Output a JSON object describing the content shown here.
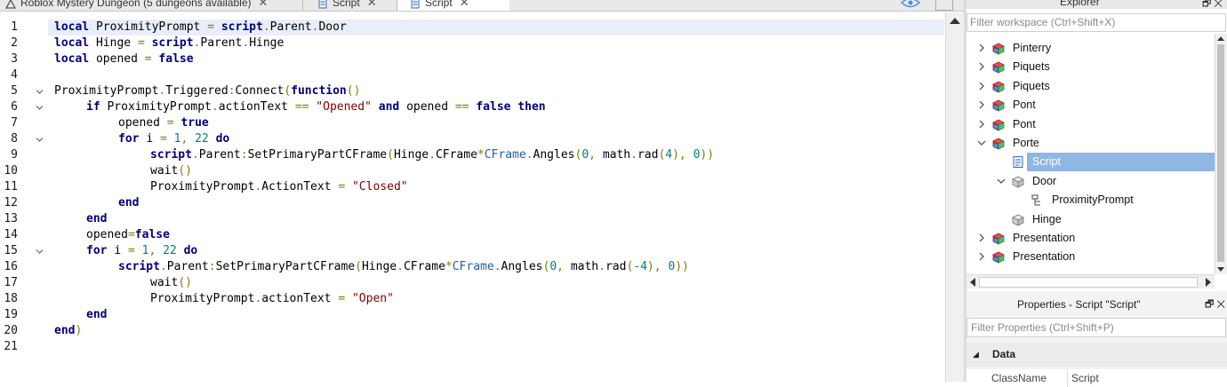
{
  "tabs": [
    {
      "label": "Roblox Mystery Dungeon (5 dungeons available)",
      "close": "✕"
    },
    {
      "label": "Script",
      "close": "✕"
    },
    {
      "label": "Script",
      "close": "✕"
    }
  ],
  "editor": {
    "lines": [
      {
        "n": "1",
        "fold": false,
        "indent": 0,
        "tokens": [
          [
            "kw",
            "local "
          ],
          [
            "idn",
            "ProximityPrompt "
          ],
          [
            "op",
            "= "
          ],
          [
            "kw",
            "script"
          ],
          [
            "op",
            "."
          ],
          [
            "idn",
            "Parent"
          ],
          [
            "op",
            "."
          ],
          [
            "idn",
            "Door"
          ]
        ]
      },
      {
        "n": "2",
        "fold": false,
        "indent": 0,
        "tokens": [
          [
            "kw",
            "local "
          ],
          [
            "idn",
            "Hinge "
          ],
          [
            "op",
            "= "
          ],
          [
            "kw",
            "script"
          ],
          [
            "op",
            "."
          ],
          [
            "idn",
            "Parent"
          ],
          [
            "op",
            "."
          ],
          [
            "idn",
            "Hinge"
          ]
        ]
      },
      {
        "n": "3",
        "fold": false,
        "indent": 0,
        "tokens": [
          [
            "kw",
            "local "
          ],
          [
            "idn",
            "opened "
          ],
          [
            "op",
            "= "
          ],
          [
            "kw",
            "false"
          ]
        ]
      },
      {
        "n": "4",
        "fold": false,
        "indent": 0,
        "tokens": []
      },
      {
        "n": "5",
        "fold": true,
        "indent": 0,
        "tokens": [
          [
            "idn",
            "ProximityPrompt"
          ],
          [
            "op",
            "."
          ],
          [
            "idn",
            "Triggered"
          ],
          [
            "op",
            ":"
          ],
          [
            "idn",
            "Connect"
          ],
          [
            "op",
            "("
          ],
          [
            "kw",
            "function"
          ],
          [
            "op",
            "()"
          ]
        ]
      },
      {
        "n": "6",
        "fold": true,
        "indent": 1,
        "tokens": [
          [
            "kw",
            "if "
          ],
          [
            "idn",
            "ProximityPrompt"
          ],
          [
            "op",
            "."
          ],
          [
            "idn",
            "actionText "
          ],
          [
            "op",
            "== "
          ],
          [
            "str",
            "\"Opened\" "
          ],
          [
            "kw",
            "and "
          ],
          [
            "idn",
            "opened "
          ],
          [
            "op",
            "== "
          ],
          [
            "kw",
            "false then"
          ]
        ]
      },
      {
        "n": "7",
        "fold": false,
        "indent": 2,
        "tokens": [
          [
            "idn",
            "opened "
          ],
          [
            "op",
            "= "
          ],
          [
            "kw",
            "true"
          ]
        ]
      },
      {
        "n": "8",
        "fold": true,
        "indent": 2,
        "tokens": [
          [
            "kw",
            "for "
          ],
          [
            "idn",
            "i "
          ],
          [
            "op",
            "= "
          ],
          [
            "num",
            "1"
          ],
          [
            "op",
            ", "
          ],
          [
            "num",
            "22 "
          ],
          [
            "kw",
            "do"
          ]
        ]
      },
      {
        "n": "9",
        "fold": false,
        "indent": 3,
        "tokens": [
          [
            "kw",
            "script"
          ],
          [
            "op",
            "."
          ],
          [
            "idn",
            "Parent"
          ],
          [
            "op",
            ":"
          ],
          [
            "idn",
            "SetPrimaryPartCFrame"
          ],
          [
            "op",
            "("
          ],
          [
            "idn",
            "Hinge"
          ],
          [
            "op",
            "."
          ],
          [
            "idn",
            "CFrame"
          ],
          [
            "op",
            "*"
          ],
          [
            "ckw",
            "CFrame"
          ],
          [
            "op",
            "."
          ],
          [
            "idn",
            "Angles"
          ],
          [
            "op",
            "("
          ],
          [
            "num",
            "0"
          ],
          [
            "op",
            ", "
          ],
          [
            "idn",
            "math"
          ],
          [
            "op",
            "."
          ],
          [
            "idn",
            "rad"
          ],
          [
            "op",
            "("
          ],
          [
            "num",
            "4"
          ],
          [
            "op",
            "), "
          ],
          [
            "num",
            "0"
          ],
          [
            "op",
            "))"
          ]
        ]
      },
      {
        "n": "10",
        "fold": false,
        "indent": 3,
        "tokens": [
          [
            "idn",
            "wait"
          ],
          [
            "op",
            "()"
          ]
        ]
      },
      {
        "n": "11",
        "fold": false,
        "indent": 3,
        "tokens": [
          [
            "idn",
            "ProximityPrompt"
          ],
          [
            "op",
            "."
          ],
          [
            "idn",
            "ActionText "
          ],
          [
            "op",
            "= "
          ],
          [
            "str",
            "\"Closed\""
          ]
        ]
      },
      {
        "n": "12",
        "fold": false,
        "indent": 2,
        "tokens": [
          [
            "kw",
            "end"
          ]
        ]
      },
      {
        "n": "13",
        "fold": false,
        "indent": 1,
        "tokens": [
          [
            "kw",
            "end"
          ]
        ]
      },
      {
        "n": "14",
        "fold": false,
        "indent": 1,
        "tokens": [
          [
            "idn",
            "opened"
          ],
          [
            "op",
            "="
          ],
          [
            "kw",
            "false"
          ]
        ]
      },
      {
        "n": "15",
        "fold": true,
        "indent": 1,
        "tokens": [
          [
            "kw",
            "for "
          ],
          [
            "idn",
            "i "
          ],
          [
            "op",
            "= "
          ],
          [
            "num",
            "1"
          ],
          [
            "op",
            ", "
          ],
          [
            "num",
            "22 "
          ],
          [
            "kw",
            "do"
          ]
        ]
      },
      {
        "n": "16",
        "fold": false,
        "indent": 2,
        "tokens": [
          [
            "kw",
            "script"
          ],
          [
            "op",
            "."
          ],
          [
            "idn",
            "Parent"
          ],
          [
            "op",
            ":"
          ],
          [
            "idn",
            "SetPrimaryPartCFrame"
          ],
          [
            "op",
            "("
          ],
          [
            "idn",
            "Hinge"
          ],
          [
            "op",
            "."
          ],
          [
            "idn",
            "CFrame"
          ],
          [
            "op",
            "*"
          ],
          [
            "ckw",
            "CFrame"
          ],
          [
            "op",
            "."
          ],
          [
            "idn",
            "Angles"
          ],
          [
            "op",
            "("
          ],
          [
            "num",
            "0"
          ],
          [
            "op",
            ", "
          ],
          [
            "idn",
            "math"
          ],
          [
            "op",
            "."
          ],
          [
            "idn",
            "rad"
          ],
          [
            "op",
            "("
          ],
          [
            "num",
            "-4"
          ],
          [
            "op",
            "), "
          ],
          [
            "num",
            "0"
          ],
          [
            "op",
            "))"
          ]
        ]
      },
      {
        "n": "17",
        "fold": false,
        "indent": 3,
        "tokens": [
          [
            "idn",
            "wait"
          ],
          [
            "op",
            "()"
          ]
        ]
      },
      {
        "n": "18",
        "fold": false,
        "indent": 3,
        "tokens": [
          [
            "idn",
            "ProximityPrompt"
          ],
          [
            "op",
            "."
          ],
          [
            "idn",
            "actionText "
          ],
          [
            "op",
            "= "
          ],
          [
            "str",
            "\"Open\""
          ]
        ]
      },
      {
        "n": "19",
        "fold": false,
        "indent": 1,
        "tokens": [
          [
            "kw",
            "end"
          ]
        ]
      },
      {
        "n": "20",
        "fold": false,
        "indent": 0,
        "tokens": [
          [
            "kw",
            "end"
          ],
          [
            "op",
            ")"
          ]
        ]
      },
      {
        "n": "21",
        "fold": false,
        "indent": 0,
        "tokens": []
      }
    ]
  },
  "explorer": {
    "title": "Explorer",
    "filter_placeholder": "Filter workspace (Ctrl+Shift+X)",
    "items": [
      {
        "label": "Pinterry",
        "depth": 0,
        "chevron": "right",
        "icon": "model-icon",
        "selected": false
      },
      {
        "label": "Piquets",
        "depth": 0,
        "chevron": "right",
        "icon": "model-icon",
        "selected": false
      },
      {
        "label": "Piquets",
        "depth": 0,
        "chevron": "right",
        "icon": "model-icon",
        "selected": false
      },
      {
        "label": "Pont",
        "depth": 0,
        "chevron": "right",
        "icon": "model-icon",
        "selected": false
      },
      {
        "label": "Pont",
        "depth": 0,
        "chevron": "right",
        "icon": "model-icon",
        "selected": false
      },
      {
        "label": "Porte",
        "depth": 0,
        "chevron": "down",
        "icon": "model-icon",
        "selected": false
      },
      {
        "label": "Script",
        "depth": 1,
        "chevron": "none",
        "icon": "script-icon",
        "selected": true
      },
      {
        "label": "Door",
        "depth": 1,
        "chevron": "down",
        "icon": "part-icon",
        "selected": false
      },
      {
        "label": "ProximityPrompt",
        "depth": 2,
        "chevron": "none",
        "icon": "prompt-icon",
        "selected": false
      },
      {
        "label": "Hinge",
        "depth": 1,
        "chevron": "none",
        "icon": "part-icon",
        "selected": false
      },
      {
        "label": "Presentation",
        "depth": 0,
        "chevron": "right",
        "icon": "model-icon",
        "selected": false
      },
      {
        "label": "Presentation",
        "depth": 0,
        "chevron": "right",
        "icon": "model-icon",
        "selected": false
      }
    ]
  },
  "properties": {
    "title": "Properties - Script \"Script\"",
    "filter_placeholder": "Filter Properties (Ctrl+Shift+P)",
    "section": "Data",
    "row": {
      "key": "ClassName",
      "value": "Script"
    }
  },
  "colors": {
    "selection": "#8fb6e5",
    "keyword": "#00007f",
    "string": "#7f0000",
    "number": "#007f7f",
    "operator": "#7f7f00"
  }
}
